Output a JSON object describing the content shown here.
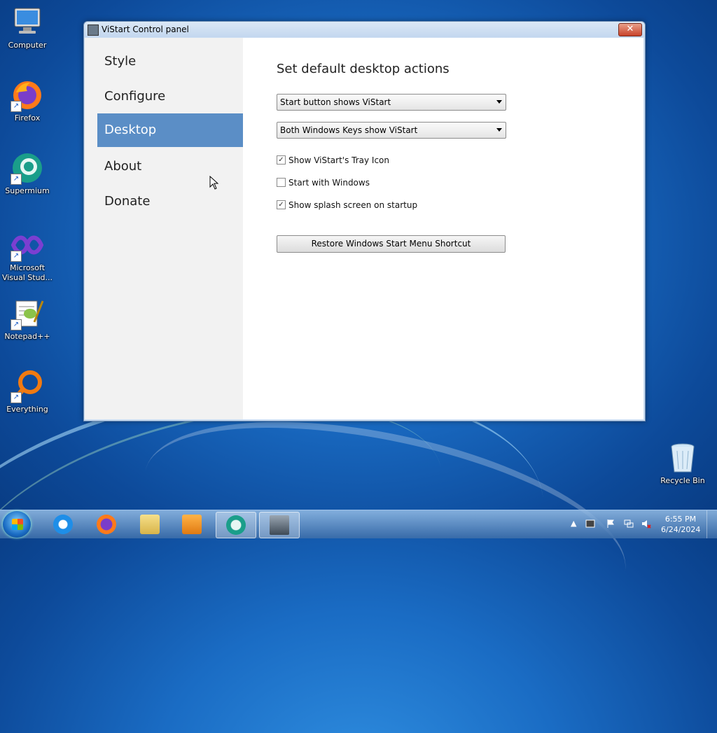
{
  "desktop": {
    "icons": [
      {
        "label": "Computer"
      },
      {
        "label": "Firefox"
      },
      {
        "label": "Supermium"
      },
      {
        "label": "Microsoft Visual Stud..."
      },
      {
        "label": "Notepad++"
      },
      {
        "label": "Everything"
      },
      {
        "label": "Recycle Bin"
      }
    ]
  },
  "window": {
    "title": "ViStart Control panel",
    "close_label": "✕",
    "sidebar": {
      "items": [
        {
          "label": "Style"
        },
        {
          "label": "Configure"
        },
        {
          "label": "Desktop"
        },
        {
          "label": "About"
        },
        {
          "label": "Donate"
        }
      ],
      "active": "Desktop"
    },
    "content": {
      "heading": "Set default desktop actions",
      "start_button_select": "Start button shows ViStart",
      "windows_keys_select": "Both Windows Keys show ViStart",
      "checkboxes": [
        {
          "label": "Show ViStart's Tray Icon",
          "checked": true
        },
        {
          "label": "Start with Windows",
          "checked": false
        },
        {
          "label": "Show splash screen on startup",
          "checked": true
        }
      ],
      "restore_button": "Restore Windows Start Menu Shortcut"
    }
  },
  "taskbar": {
    "pinned": [
      "internet-explorer-icon",
      "firefox-icon",
      "file-explorer-icon",
      "media-player-icon",
      "supermium-icon",
      "vistart-icon"
    ],
    "clock": {
      "time": "6:55 PM",
      "date": "6/24/2024"
    },
    "tray_arrow": "▲"
  },
  "colors": {
    "accent": "#5b8ec6",
    "desktop_bg": "#1a6cc4"
  }
}
